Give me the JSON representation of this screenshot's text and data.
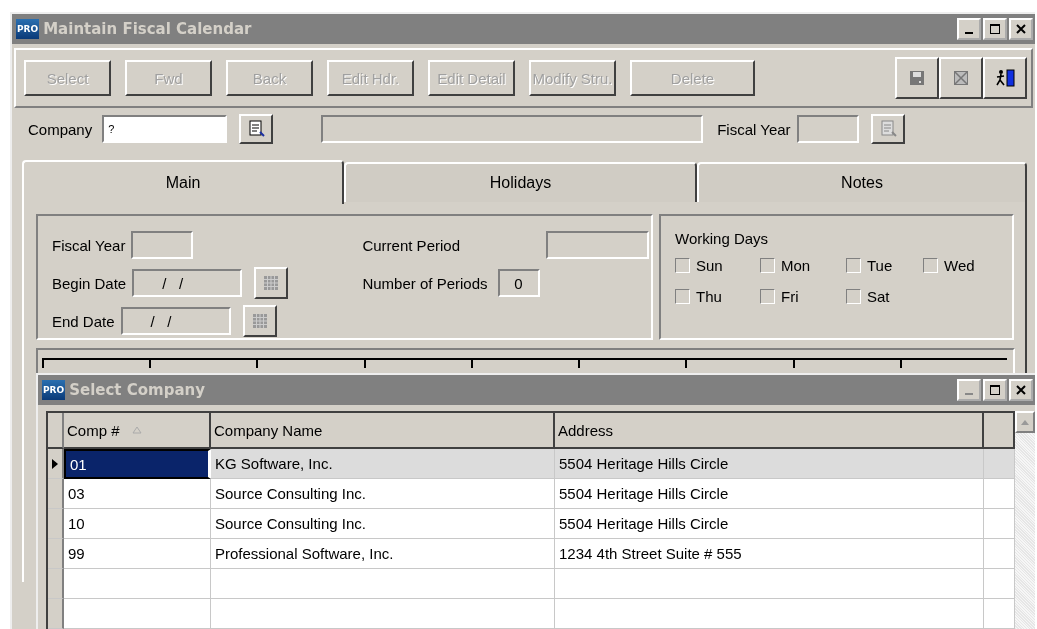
{
  "window": {
    "title": "Maintain Fiscal Calendar",
    "app_badge": "PRO"
  },
  "toolbar": {
    "buttons": [
      {
        "label": "Select",
        "disabled": true
      },
      {
        "label": "Fwd",
        "disabled": true
      },
      {
        "label": "Back",
        "disabled": true
      },
      {
        "label": "Edit Hdr.",
        "disabled": true
      },
      {
        "label": "Edit Detail",
        "disabled": true
      },
      {
        "label": "Modify Stru.",
        "disabled": true
      },
      {
        "label": "Delete",
        "disabled": true
      }
    ]
  },
  "header": {
    "company_label": "Company",
    "company_value": "?",
    "fiscal_year_label": "Fiscal Year"
  },
  "tabs": [
    {
      "label": "Main",
      "selected": true
    },
    {
      "label": "Holidays",
      "selected": false
    },
    {
      "label": "Notes",
      "selected": false
    }
  ],
  "period_fields": {
    "fiscal_year_label": "Fiscal Year",
    "begin_date_label": "Begin Date",
    "begin_date_value": "/   /",
    "end_date_label": "End Date",
    "end_date_value": "/   /",
    "current_period_label": "Current Period",
    "number_of_periods_label": "Number of Periods",
    "number_of_periods_value": "0"
  },
  "working_days": {
    "title": "Working Days",
    "days": [
      {
        "label": "Sun",
        "checked": false
      },
      {
        "label": "Mon",
        "checked": false
      },
      {
        "label": "Tue",
        "checked": false
      },
      {
        "label": "Wed",
        "checked": false
      },
      {
        "label": "Thu",
        "checked": false
      },
      {
        "label": "Fri",
        "checked": false
      },
      {
        "label": "Sat",
        "checked": false
      }
    ]
  },
  "dialog": {
    "title": "Select Company",
    "app_badge": "PRO",
    "columns": [
      "Comp #",
      "Company Name",
      "Address"
    ],
    "rows": [
      {
        "comp": "01",
        "name": "KG Software, Inc.",
        "address": "5504 Heritage Hills Circle",
        "selected": true
      },
      {
        "comp": "03",
        "name": "Source Consulting Inc.",
        "address": "5504 Heritage Hills Circle",
        "selected": false
      },
      {
        "comp": "10",
        "name": "Source Consulting Inc.",
        "address": "5504 Heritage Hills Circle",
        "selected": false
      },
      {
        "comp": "99",
        "name": "Professional Software, Inc.",
        "address": "1234 4th Street Suite # 555",
        "selected": false
      }
    ]
  }
}
